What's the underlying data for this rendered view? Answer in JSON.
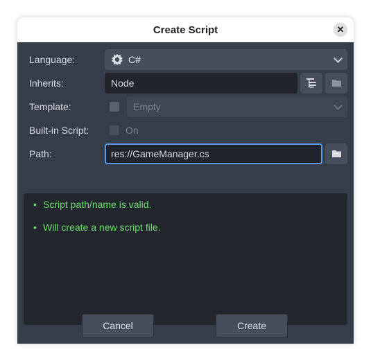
{
  "dialog": {
    "title": "Create Script",
    "close_glyph": "✕"
  },
  "form": {
    "language": {
      "label": "Language:",
      "value": "C#",
      "icon": "csharp-gear-icon"
    },
    "inherits": {
      "label": "Inherits:",
      "value": "Node",
      "icon_tree": "class-tree-icon",
      "icon_browse": "folder-icon"
    },
    "template": {
      "label": "Template:",
      "value": "Empty",
      "enabled": false
    },
    "builtin": {
      "label": "Built-in Script:",
      "toggle_label": "On",
      "enabled": false
    },
    "path": {
      "label": "Path:",
      "value": "res://GameManager.cs",
      "icon_browse": "folder-icon"
    }
  },
  "messages": [
    {
      "bullet": "•",
      "text": "Script path/name is valid."
    },
    {
      "bullet": "•",
      "text": "Will create a new script file."
    }
  ],
  "footer": {
    "cancel_label": "Cancel",
    "create_label": "Create"
  },
  "colors": {
    "panel": "#363d4a",
    "field_dark": "#20242b",
    "success_text": "#6fdb6f",
    "focus_border": "#5b9ae0"
  }
}
